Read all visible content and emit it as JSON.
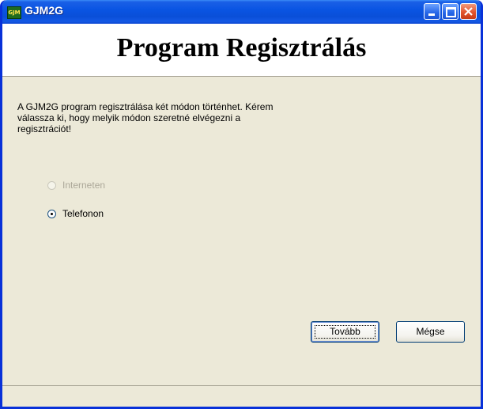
{
  "window": {
    "title": "GJM2G",
    "icon": "gjm-app-icon",
    "icon_text": "GJM"
  },
  "header": {
    "title": "Program Regisztrálás"
  },
  "description": "A GJM2G program regisztrálása két módon történhet. Kérem\nválassza ki, hogy melyik módon szeretné elvégezni a\nregisztrációt!",
  "options": [
    {
      "label": "Interneten",
      "selected": false,
      "enabled": false
    },
    {
      "label": "Telefonon",
      "selected": true,
      "enabled": true
    }
  ],
  "buttons": {
    "next": "Tovább",
    "cancel": "Mégse"
  },
  "colors": {
    "titlebar": "#0a55e3",
    "face": "#ece9d8",
    "header_bg": "#ffffff",
    "disabled_text": "#aca899"
  }
}
